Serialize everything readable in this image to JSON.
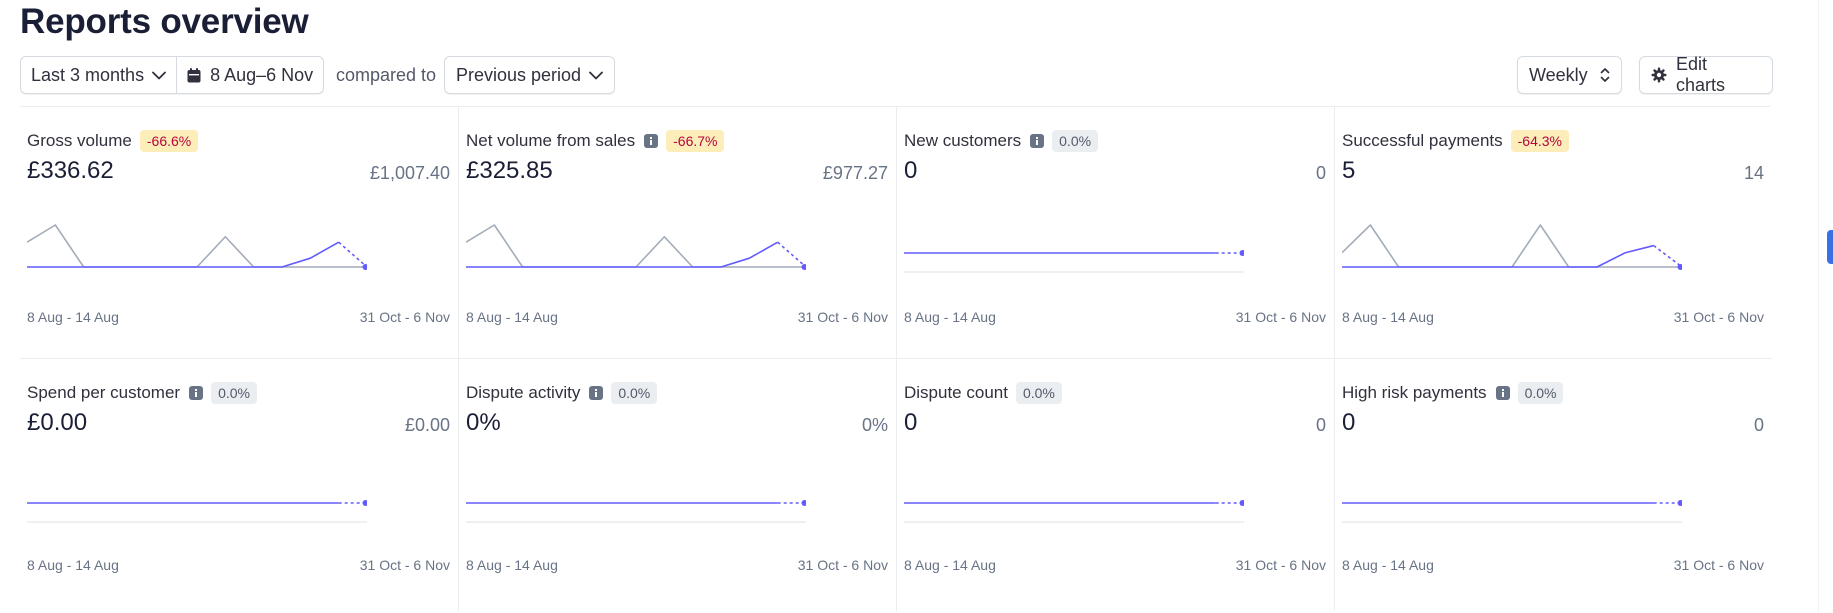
{
  "page": {
    "title": "Reports overview"
  },
  "toolbar": {
    "range_label": "Last 3 months",
    "date_range": "8 Aug–6 Nov",
    "compared_to": "compared to",
    "comparison_label": "Previous period",
    "interval_label": "Weekly",
    "edit_label": "Edit charts"
  },
  "colors": {
    "current_series": "#635bff",
    "previous_series": "#a3acb9",
    "warn_badge_bg": "#fcedb9",
    "warn_badge_text": "#b3063d",
    "neutral_badge_bg": "#ebeef1"
  },
  "cards": [
    {
      "title": "Gross volume",
      "info": false,
      "change": "-66.6%",
      "tone": "warn",
      "current": "£336.62",
      "previous": "£1,007.40",
      "axis_start": "8 Aug - 14 Aug",
      "axis_end": "31 Oct - 6 Nov",
      "current_series": [
        0,
        0,
        0,
        0,
        0,
        0,
        0,
        0,
        0,
        0,
        0.21,
        0.59,
        0
      ],
      "previous_series": [
        0.59,
        1,
        0,
        0,
        0,
        0,
        0,
        0.72,
        0,
        0,
        0,
        0,
        0
      ]
    },
    {
      "title": "Net volume from sales",
      "info": true,
      "change": "-66.7%",
      "tone": "warn",
      "current": "£325.85",
      "previous": "£977.27",
      "axis_start": "8 Aug - 14 Aug",
      "axis_end": "31 Oct - 6 Nov",
      "current_series": [
        0,
        0,
        0,
        0,
        0,
        0,
        0,
        0,
        0,
        0,
        0.21,
        0.59,
        0
      ],
      "previous_series": [
        0.59,
        1,
        0,
        0,
        0,
        0,
        0,
        0.72,
        0,
        0,
        0,
        0,
        0
      ]
    },
    {
      "title": "New customers",
      "info": true,
      "change": "0.0%",
      "tone": "neutral",
      "current": "0",
      "previous": "0",
      "axis_start": "8 Aug - 14 Aug",
      "axis_end": "31 Oct - 6 Nov",
      "current_series": [
        0,
        0,
        0,
        0,
        0,
        0,
        0,
        0,
        0,
        0,
        0,
        0,
        0
      ],
      "previous_series": []
    },
    {
      "title": "Successful payments",
      "info": false,
      "change": "-64.3%",
      "tone": "warn",
      "current": "5",
      "previous": "14",
      "axis_start": "8 Aug - 14 Aug",
      "axis_end": "31 Oct - 6 Nov",
      "current_series": [
        0,
        0,
        0,
        0,
        0,
        0,
        0,
        0,
        0,
        0,
        0.34,
        0.51,
        0
      ],
      "previous_series": [
        0.34,
        1,
        0,
        0,
        0,
        0,
        0,
        1,
        0,
        0,
        0,
        0,
        0
      ]
    },
    {
      "title": "Spend per customer",
      "info": true,
      "change": "0.0%",
      "tone": "neutral",
      "current": "£0.00",
      "previous": "£0.00",
      "axis_start": "8 Aug - 14 Aug",
      "axis_end": "31 Oct - 6 Nov",
      "current_series": [
        0,
        0,
        0,
        0,
        0,
        0,
        0,
        0,
        0,
        0,
        0,
        0,
        0
      ],
      "previous_series": []
    },
    {
      "title": "Dispute activity",
      "info": true,
      "change": "0.0%",
      "tone": "neutral",
      "current": "0%",
      "previous": "0%",
      "axis_start": "8 Aug - 14 Aug",
      "axis_end": "31 Oct - 6 Nov",
      "current_series": [
        0,
        0,
        0,
        0,
        0,
        0,
        0,
        0,
        0,
        0,
        0,
        0,
        0
      ],
      "previous_series": []
    },
    {
      "title": "Dispute count",
      "info": false,
      "change": "0.0%",
      "tone": "neutral",
      "current": "0",
      "previous": "0",
      "axis_start": "8 Aug - 14 Aug",
      "axis_end": "31 Oct - 6 Nov",
      "current_series": [
        0,
        0,
        0,
        0,
        0,
        0,
        0,
        0,
        0,
        0,
        0,
        0,
        0
      ],
      "previous_series": []
    },
    {
      "title": "High risk payments",
      "info": true,
      "change": "0.0%",
      "tone": "neutral",
      "current": "0",
      "previous": "0",
      "axis_start": "8 Aug - 14 Aug",
      "axis_end": "31 Oct - 6 Nov",
      "current_series": [
        0,
        0,
        0,
        0,
        0,
        0,
        0,
        0,
        0,
        0,
        0,
        0,
        0
      ],
      "previous_series": []
    }
  ]
}
